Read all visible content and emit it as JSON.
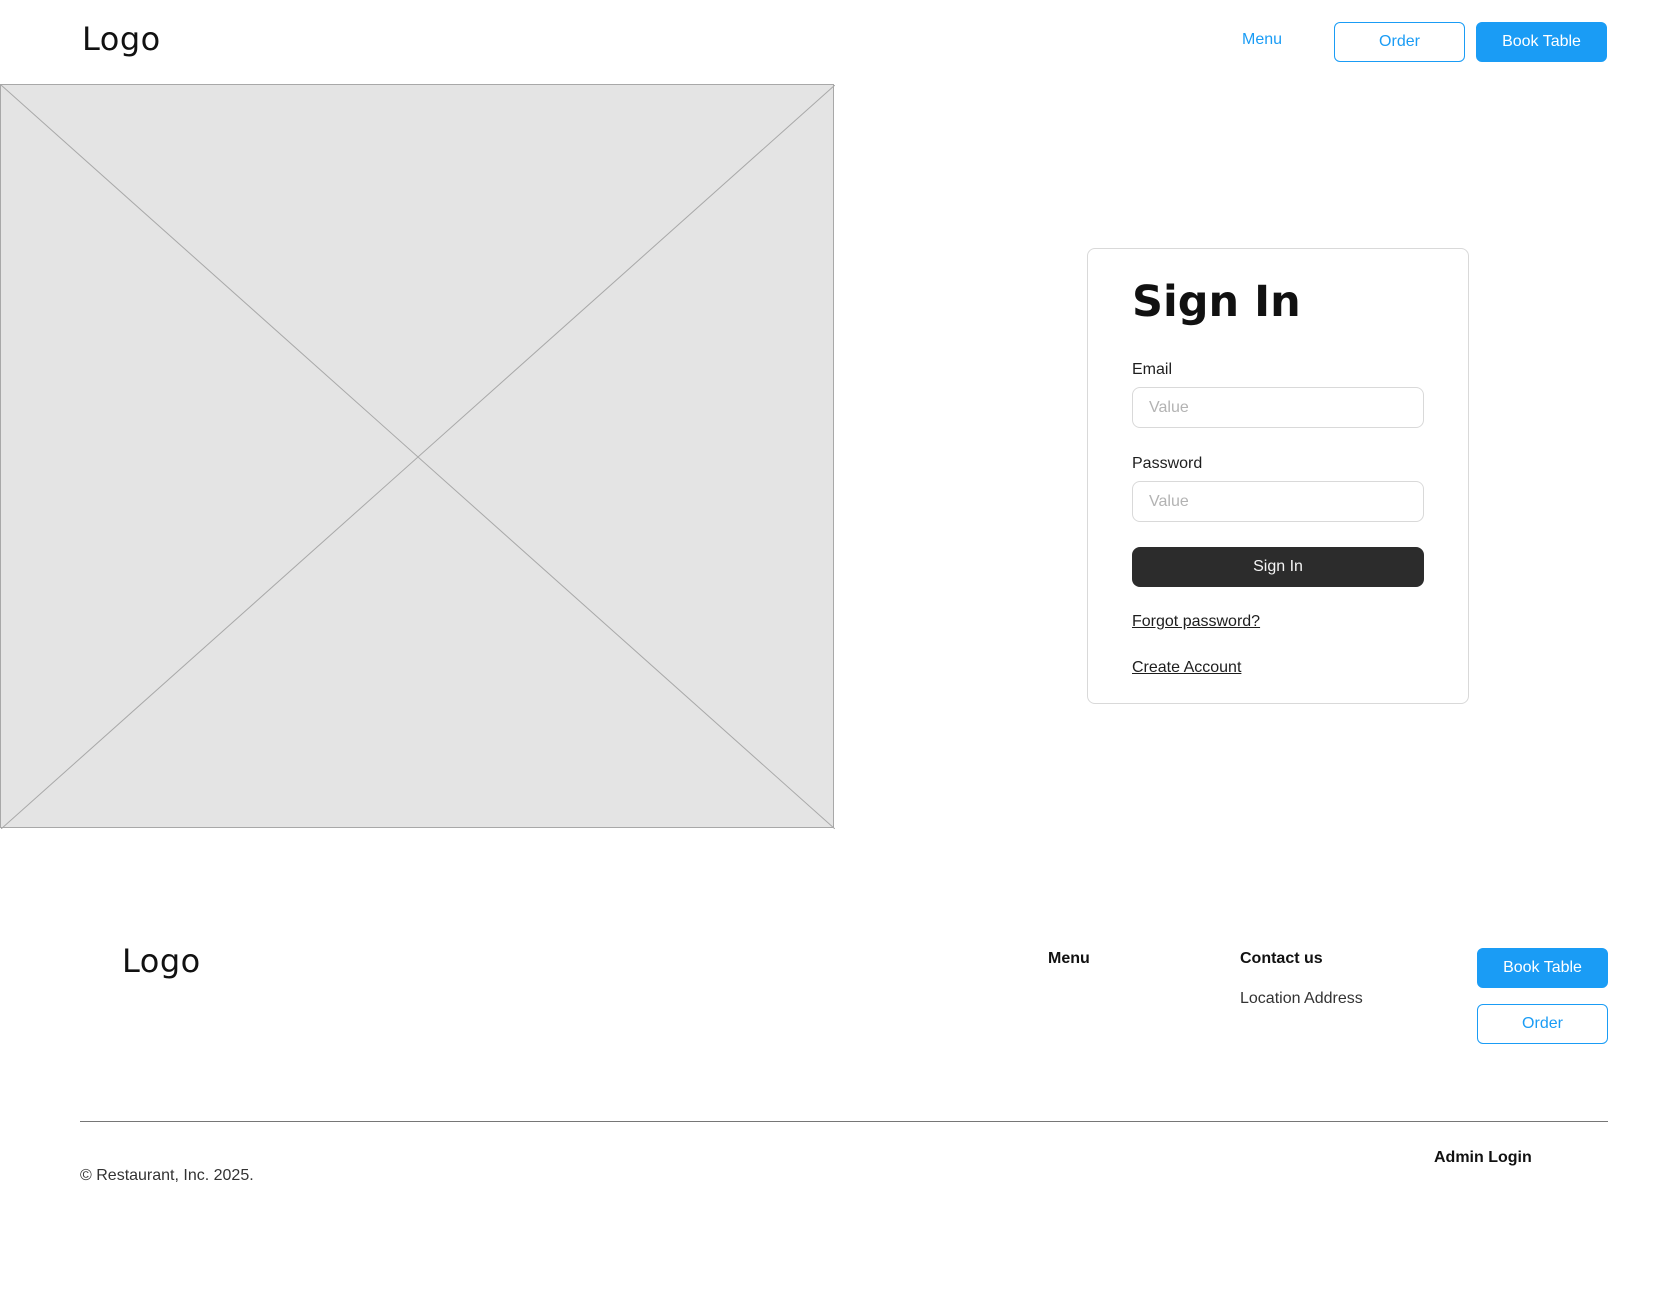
{
  "header": {
    "logo": "Logo",
    "nav_menu": "Menu",
    "order_label": "Order",
    "book_table_label": "Book Table"
  },
  "signin": {
    "title": "Sign In",
    "email_label": "Email",
    "email_placeholder": "Value",
    "password_label": "Password",
    "password_placeholder": "Value",
    "submit_label": "Sign In",
    "forgot_link": "Forgot password?",
    "create_link": "Create Account"
  },
  "footer": {
    "logo": "Logo",
    "menu_heading": "Menu",
    "contact_heading": "Contact us",
    "address": "Location Address",
    "book_table_label": "Book Table",
    "order_label": "Order",
    "copyright": "© Restaurant, Inc. 2025.",
    "admin_login": "Admin Login"
  },
  "colors": {
    "accent": "#1a9cf5",
    "dark_button": "#2c2c2c",
    "placeholder_fill": "#e4e4e4"
  }
}
